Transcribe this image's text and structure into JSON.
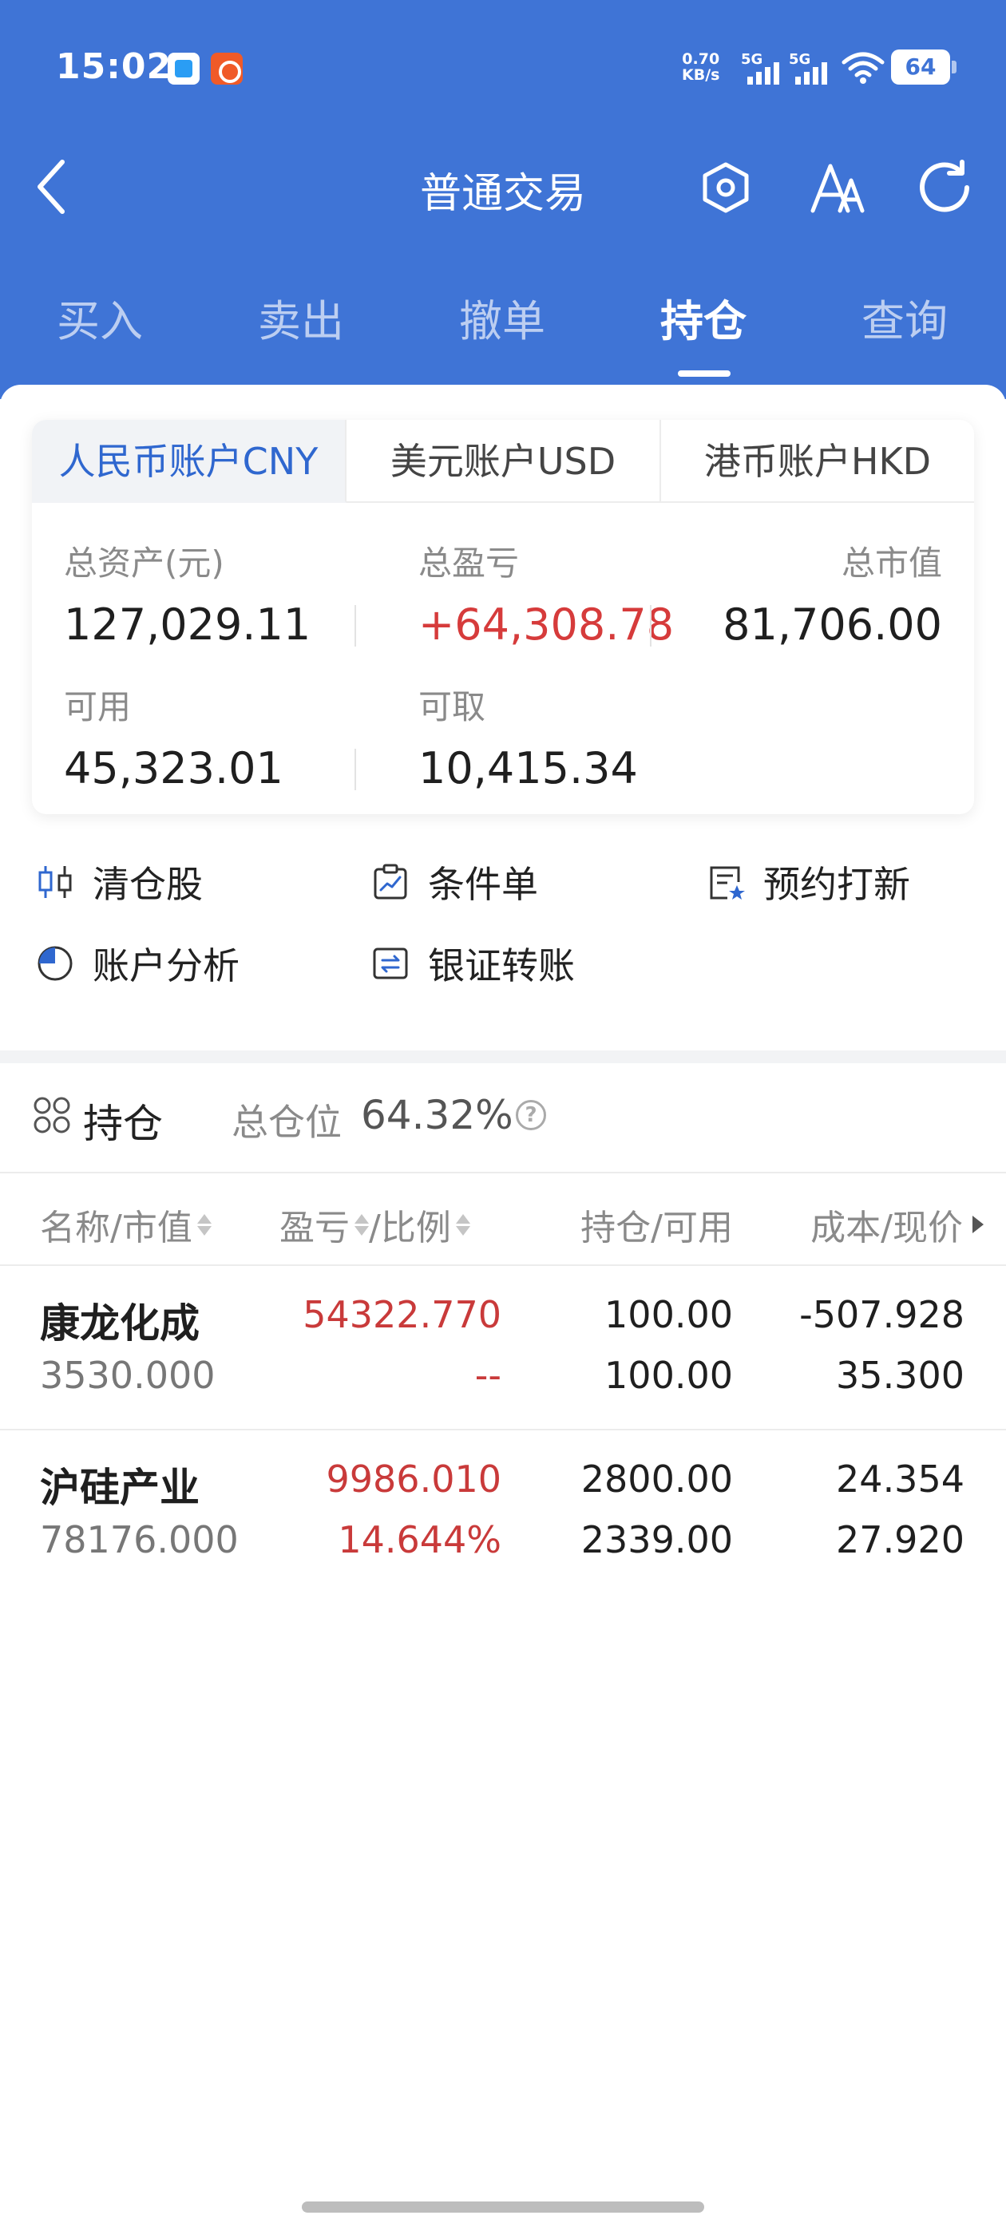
{
  "status_bar": {
    "time": "15:02",
    "net_speed_value": "0.70",
    "net_speed_unit": "KB/s",
    "signal1_label": "5G",
    "signal2_label": "5G",
    "battery": "64"
  },
  "nav": {
    "title": "普通交易",
    "icons": [
      "chevron-left-icon",
      "settings-hexagon-icon",
      "font-size-icon",
      "refresh-icon"
    ]
  },
  "tabs": [
    {
      "label": "买入",
      "active": false
    },
    {
      "label": "卖出",
      "active": false
    },
    {
      "label": "撤单",
      "active": false
    },
    {
      "label": "持仓",
      "active": true
    },
    {
      "label": "查询",
      "active": false
    }
  ],
  "account": {
    "tabs": [
      {
        "label": "人民币账户CNY",
        "active": true
      },
      {
        "label": "美元账户USD",
        "active": false
      },
      {
        "label": "港币账户HKD",
        "active": false
      }
    ],
    "total_assets_label": "总资产(元)",
    "total_assets_value": "127,029.11",
    "total_pnl_label": "总盈亏",
    "total_pnl_value": "+64,308.78",
    "market_value_label": "总市值",
    "market_value_value": "81,706.00",
    "available_label": "可用",
    "available_value": "45,323.01",
    "withdrawable_label": "可取",
    "withdrawable_value": "10,415.34"
  },
  "actions": [
    {
      "label": "清仓股",
      "icon": "candlestick-icon"
    },
    {
      "label": "条件单",
      "icon": "clipboard-chart-icon"
    },
    {
      "label": "预约打新",
      "icon": "star-document-icon"
    },
    {
      "label": "账户分析",
      "icon": "pie-chart-icon"
    },
    {
      "label": "银证转账",
      "icon": "transfer-icon"
    }
  ],
  "holdings": {
    "title": "持仓",
    "position_label": "总仓位",
    "position_value": "64.32%",
    "help_symbol": "?",
    "columns": {
      "name": "名称/市值",
      "pnl": "盈亏",
      "ratio": "/比例",
      "qty": "持仓/可用",
      "cost": "成本/现价"
    },
    "rows": [
      {
        "name": "康龙化成",
        "market_value": "3530.000",
        "pnl": "54322.770",
        "ratio": "--",
        "position": "100.00",
        "available": "100.00",
        "cost": "-507.928",
        "price": "35.300"
      },
      {
        "name": "沪硅产业",
        "market_value": "78176.000",
        "pnl": "9986.010",
        "ratio": "14.644%",
        "position": "2800.00",
        "available": "2339.00",
        "cost": "24.354",
        "price": "27.920"
      }
    ]
  },
  "colors": {
    "header_blue": "#3f74d6",
    "profit_red": "#c93a3a",
    "active_tab_blue": "#2f67cf"
  }
}
